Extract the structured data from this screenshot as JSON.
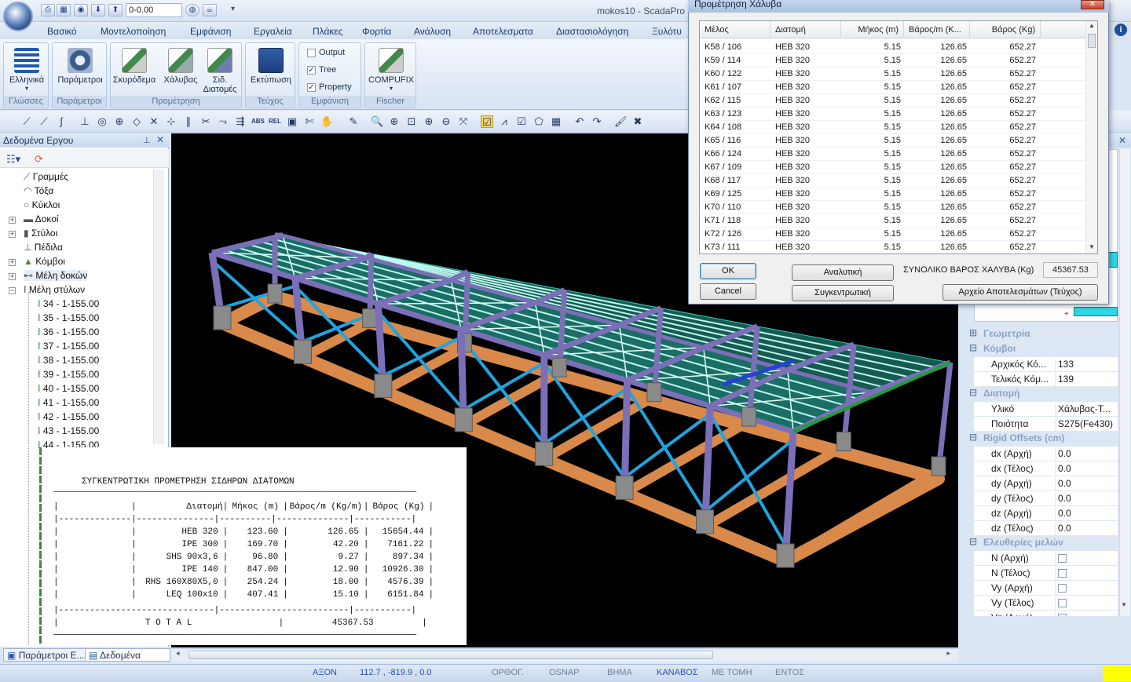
{
  "app": {
    "title": "mokos10 - ScadaPro",
    "quick_combo": "0-0.00",
    "tabs": [
      "Βασικό",
      "Μοντελοποίηση",
      "Εμφάνιση",
      "Εργαλεία",
      "Πλάκες",
      "Φορτία",
      "Ανάλυση",
      "Αποτελεσματα",
      "Διαστασιολόγηση",
      "Ξυλότυ"
    ]
  },
  "ribbon": {
    "groups": [
      {
        "label": "Γλώσσες",
        "buttons": [
          "Ελληνικά"
        ]
      },
      {
        "label": "Παράμετροι",
        "buttons": [
          "Παράμετροι"
        ]
      },
      {
        "label": "Προμέτρηση",
        "buttons": [
          "Σκυρόδεμα",
          "Χάλυβας",
          "Σιδ. Διατομές"
        ]
      },
      {
        "label": "Τεύχος",
        "buttons": [
          "Εκτύπωση"
        ]
      },
      {
        "label": "Εμφάνιση",
        "checks": [
          {
            "label": "Output",
            "checked": false
          },
          {
            "label": "Tree",
            "checked": true
          },
          {
            "label": "Property",
            "checked": true
          }
        ]
      },
      {
        "label": "Fischer",
        "buttons": [
          "COMPUFIX"
        ]
      }
    ]
  },
  "left_panel": {
    "title": "Δεδομένα Εργου",
    "tree": [
      {
        "label": "Γραμμές",
        "expandable": false
      },
      {
        "label": "Τόξα",
        "expandable": false
      },
      {
        "label": "Κύκλοι",
        "expandable": false
      },
      {
        "label": "Δοκοί",
        "expandable": true
      },
      {
        "label": "Στύλοι",
        "expandable": true
      },
      {
        "label": "Πέδιλα",
        "expandable": false
      },
      {
        "label": "Κόμβοι",
        "expandable": true
      },
      {
        "label": "Μέλη δοκών",
        "expandable": true
      },
      {
        "label": "Μέλη στύλων",
        "expandable": true,
        "expanded": true
      }
    ],
    "children": [
      "34 - 1-155.00",
      "35 - 1-155.00",
      "36 - 1-155.00",
      "37 - 1-155.00",
      "38 - 1-155.00",
      "39 - 1-155.00",
      "40 - 1-155.00",
      "41 - 1-155.00",
      "42 - 1-155.00",
      "43 - 1-155.00",
      "44 - 1-155.00"
    ],
    "bottom_tabs": [
      "Παράμετροι Ε...",
      "Δεδομένα Εργ..."
    ]
  },
  "report": {
    "title": "ΣΥΓΚΕΝΤΡΩΤΙΚΗ ΠΡΟΜΕΤΡΗΣΗ ΣΙΔΗΡΩΝ ΔΙΑΤΟΜΩΝ",
    "headers": [
      "Διατομή",
      "Μήκος (m)",
      "Βάρος/m (Kg/m)",
      "Βάρος (Kg)"
    ],
    "rows": [
      [
        "HEB 320",
        "123.60",
        "126.65",
        "15654.44"
      ],
      [
        "IPE 300",
        "169.70",
        "42.20",
        "7161.22"
      ],
      [
        "SHS 90x3,6",
        "96.80",
        "9.27",
        "897.34"
      ],
      [
        "IPE 140",
        "847.00",
        "12.90",
        "10926.30"
      ],
      [
        "RHS 160X80X5,0",
        "254.24",
        "18.00",
        "4576.39"
      ],
      [
        "LEQ 100x10",
        "407.41",
        "15.10",
        "6151.84"
      ]
    ],
    "total_label": "T O T A L",
    "total_value": "45367.53"
  },
  "dialog": {
    "title": "Προμέτρηση Χάλυβα",
    "columns": [
      "Μέλος",
      "Διατομή",
      "Μήκος (m)",
      "Βάρος/m (K...",
      "Βάρος (Kg)"
    ],
    "rows": [
      [
        "K58 / 106",
        "HEB 320",
        "5.15",
        "126.65",
        "652.27"
      ],
      [
        "K59 / 114",
        "HEB 320",
        "5.15",
        "126.65",
        "652.27"
      ],
      [
        "K60 / 122",
        "HEB 320",
        "5.15",
        "126.65",
        "652.27"
      ],
      [
        "K61 / 107",
        "HEB 320",
        "5.15",
        "126.65",
        "652.27"
      ],
      [
        "K62 / 115",
        "HEB 320",
        "5.15",
        "126.65",
        "652.27"
      ],
      [
        "K63 / 123",
        "HEB 320",
        "5.15",
        "126.65",
        "652.27"
      ],
      [
        "K64 / 108",
        "HEB 320",
        "5.15",
        "126.65",
        "652.27"
      ],
      [
        "K65 / 116",
        "HEB 320",
        "5.15",
        "126.65",
        "652.27"
      ],
      [
        "K66 / 124",
        "HEB 320",
        "5.15",
        "126.65",
        "652.27"
      ],
      [
        "K67 / 109",
        "HEB 320",
        "5.15",
        "126.65",
        "652.27"
      ],
      [
        "K68 / 117",
        "HEB 320",
        "5.15",
        "126.65",
        "652.27"
      ],
      [
        "K69 / 125",
        "HEB 320",
        "5.15",
        "126.65",
        "652.27"
      ],
      [
        "K70 / 110",
        "HEB 320",
        "5.15",
        "126.65",
        "652.27"
      ],
      [
        "K71 / 118",
        "HEB 320",
        "5.15",
        "126.65",
        "652.27"
      ],
      [
        "K72 / 126",
        "HEB 320",
        "5.15",
        "126.65",
        "652.27"
      ],
      [
        "K73 / 111",
        "HEB 320",
        "5.15",
        "126.65",
        "652.27"
      ]
    ],
    "ok_label": "OK",
    "cancel_label": "Cancel",
    "analytic_label": "Αναλυτική",
    "summary_label": "Συγκεντρωτική",
    "total_label": "ΣΥΝΟΛΙΚΟ ΒΑΡΟΣ ΧΑΛΥΒΑ (Kg)",
    "total_value": "45367.53",
    "export_label": "Αρχείο Αποτελεσμάτων (Τεύχος)"
  },
  "properties": {
    "categories": [
      {
        "label": "Γεωμετρία",
        "rows": []
      },
      {
        "label": "Κόμβοι",
        "rows": [
          [
            "Αρχικός Κό...",
            "133"
          ],
          [
            "Τελικός Κόμ...",
            "139"
          ]
        ]
      },
      {
        "label": "Διατομή",
        "rows": [
          [
            "Υλικό",
            "Χάλυβας-Τ..."
          ],
          [
            "Ποιότητα",
            "S275(Fe430)"
          ]
        ]
      },
      {
        "label": "Rigid Offsets (cm)",
        "rows": [
          [
            "dx (Αρχή)",
            "0.0"
          ],
          [
            "dx (Τέλος)",
            "0.0"
          ],
          [
            "dy (Αρχή)",
            "0.0"
          ],
          [
            "dy (Τέλος)",
            "0.0"
          ],
          [
            "dz (Αρχή)",
            "0.0"
          ],
          [
            "dz (Τέλος)",
            "0.0"
          ]
        ]
      },
      {
        "label": "Ελευθερίες μελών",
        "checks": [
          "N (Αρχή)",
          "N (Τέλος)",
          "Vy (Αρχή)",
          "Vy (Τέλος)",
          "Vz (Αρχή)"
        ]
      }
    ]
  },
  "statusbar": {
    "items": [
      "ΑΞΟΝ",
      "112.7 , -819.9 , 0.0",
      "ΟΡΘΟΓ.",
      "OSNAP",
      "ΒΗΜΑ",
      "ΚΑΝΑΒΟΣ",
      "ΜΕ ΤΟΜΗ",
      "ΕΝΤΟΣ"
    ]
  },
  "colors": {
    "accent": "#1f3a66",
    "roof": "#2fc9b6",
    "steel": "#7b6fb8",
    "brace": "#1fa4e0",
    "foundation": "#d98a4a",
    "pedestal": "#8a8a8a"
  }
}
